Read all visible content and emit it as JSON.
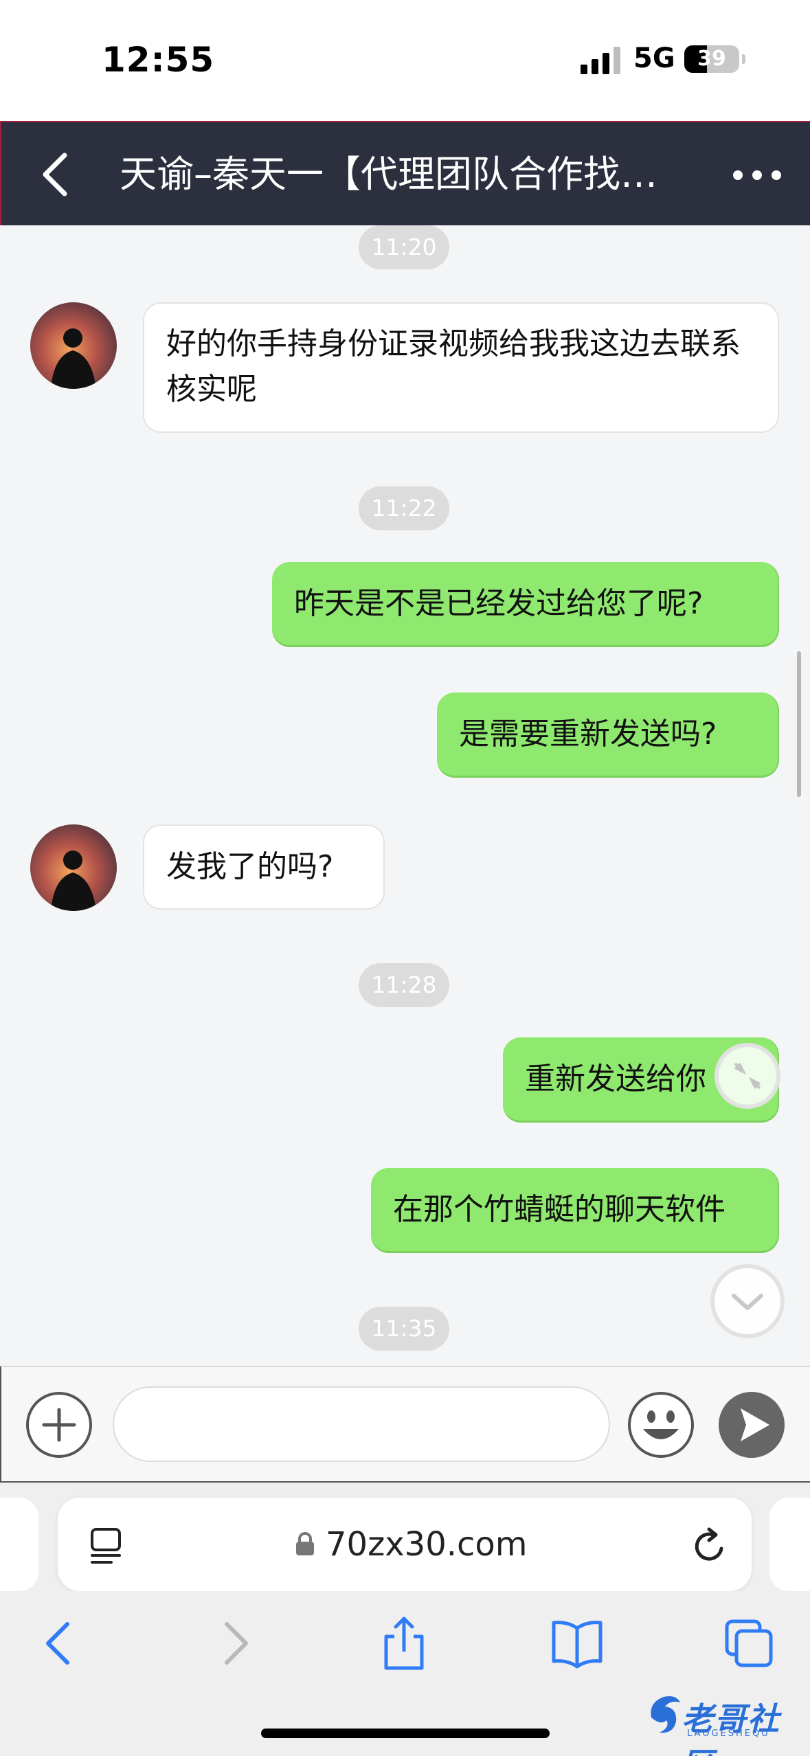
{
  "status_bar": {
    "time": "12:55",
    "network": "5G",
    "battery": "39"
  },
  "header": {
    "title": "天谕–秦天一【代理团队合作找…"
  },
  "messages": {
    "t1": "11:20",
    "m1": "好的你手持身份证录视频给我我这边去联系核实呢",
    "t2": "11:22",
    "m2": "昨天是不是已经发过给您了呢?",
    "m3": "是需要重新发送吗?",
    "m4": "发我了的吗?",
    "t3": "11:28",
    "m5": "重新发送给你",
    "m6": "在那个竹蜻蜓的聊天软件",
    "t4": "11:35"
  },
  "input": {
    "placeholder": "",
    "value": ""
  },
  "browser": {
    "url": "70zx30.com"
  },
  "watermark": {
    "text": "老哥社区",
    "sub": "LAOGESHEQU"
  },
  "colors": {
    "header_bg": "#2b2f3e",
    "outgoing_bubble": "#8fe96f",
    "chat_bg": "#f4f5f7",
    "browser_accent": "#2f7cf6"
  },
  "icons": [
    "back-icon",
    "more-icon",
    "plus-icon",
    "emoji-icon",
    "send-icon",
    "lock-icon",
    "reader-icon",
    "reload-icon",
    "collapse-icon",
    "chevron-down-icon",
    "safari-back-icon",
    "safari-forward-icon",
    "share-icon",
    "bookmarks-icon",
    "tabs-icon"
  ]
}
